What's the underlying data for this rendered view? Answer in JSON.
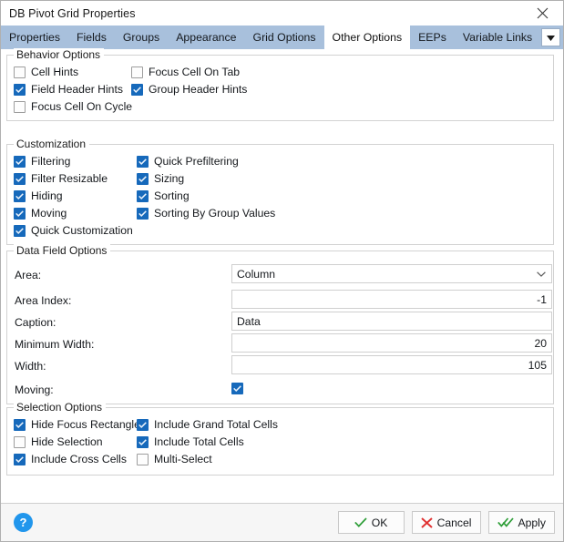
{
  "window": {
    "title": "DB Pivot Grid Properties",
    "close_icon": "close-icon"
  },
  "tabs": {
    "items": [
      {
        "label": "Properties",
        "active": false
      },
      {
        "label": "Fields",
        "active": false
      },
      {
        "label": "Groups",
        "active": false
      },
      {
        "label": "Appearance",
        "active": false
      },
      {
        "label": "Grid Options",
        "active": false
      },
      {
        "label": "Other Options",
        "active": true
      },
      {
        "label": "EEPs",
        "active": false
      },
      {
        "label": "Variable Links",
        "active": false
      }
    ],
    "overflow_icon": "chevron-down-icon"
  },
  "groups": {
    "behavior": {
      "title": "Behavior Options",
      "items": [
        {
          "label": "Cell Hints",
          "checked": false
        },
        {
          "label": "Focus Cell On Tab",
          "checked": false
        },
        {
          "label": "Field Header Hints",
          "checked": true
        },
        {
          "label": "Group Header Hints",
          "checked": true
        },
        {
          "label": "Focus Cell On Cycle",
          "checked": false
        }
      ]
    },
    "customization": {
      "title": "Customization",
      "items": [
        {
          "label": "Filtering",
          "checked": true
        },
        {
          "label": "Quick Prefiltering",
          "checked": true
        },
        {
          "label": "Filter Resizable",
          "checked": true
        },
        {
          "label": "Sizing",
          "checked": true
        },
        {
          "label": "Hiding",
          "checked": true
        },
        {
          "label": "Sorting",
          "checked": true
        },
        {
          "label": "Moving",
          "checked": true
        },
        {
          "label": "Sorting By Group Values",
          "checked": true
        },
        {
          "label": "Quick Customization",
          "checked": true
        }
      ]
    },
    "data_field": {
      "title": "Data Field Options",
      "fields": [
        {
          "label": "Area:",
          "value": "Column",
          "type": "combo",
          "align": "left"
        },
        {
          "label": "Area Index:",
          "value": "-1",
          "type": "text",
          "align": "right"
        },
        {
          "label": "Caption:",
          "value": "Data",
          "type": "text",
          "align": "left"
        },
        {
          "label": "Minimum Width:",
          "value": "20",
          "type": "text",
          "align": "right"
        },
        {
          "label": "Width:",
          "value": "105",
          "type": "text",
          "align": "right"
        },
        {
          "label": "Moving:",
          "value": "",
          "type": "checkbox",
          "checked": true
        }
      ]
    },
    "selection": {
      "title": "Selection Options",
      "items": [
        {
          "label": "Hide Focus Rectangle",
          "checked": true
        },
        {
          "label": "Include Grand Total Cells",
          "checked": true
        },
        {
          "label": "Hide Selection",
          "checked": false
        },
        {
          "label": "Include Total Cells",
          "checked": true
        },
        {
          "label": "Include Cross Cells",
          "checked": true
        },
        {
          "label": "Multi-Select",
          "checked": false
        }
      ]
    }
  },
  "footer": {
    "help_label": "?",
    "buttons": [
      {
        "label": "OK",
        "icon": "check-icon"
      },
      {
        "label": "Cancel",
        "icon": "cross-icon"
      },
      {
        "label": "Apply",
        "icon": "double-check-icon"
      }
    ]
  },
  "colors": {
    "tabbar": "#a8c0dc",
    "checkbox_checked": "#1669bb",
    "help_blue": "#2196ec",
    "ok_green": "#2e9e38",
    "cancel_red": "#e03030"
  }
}
